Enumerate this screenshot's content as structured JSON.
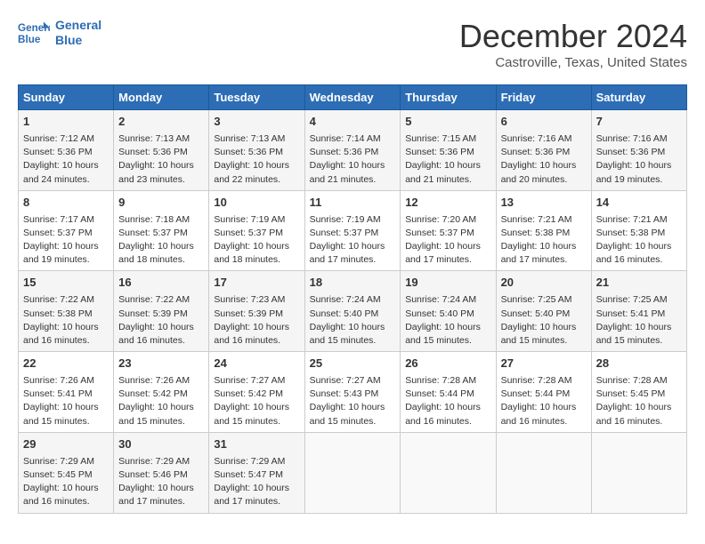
{
  "logo": {
    "line1": "General",
    "line2": "Blue"
  },
  "title": "December 2024",
  "subtitle": "Castroville, Texas, United States",
  "days_of_week": [
    "Sunday",
    "Monday",
    "Tuesday",
    "Wednesday",
    "Thursday",
    "Friday",
    "Saturday"
  ],
  "weeks": [
    [
      {
        "day": 1,
        "sunrise": "7:12 AM",
        "sunset": "5:36 PM",
        "daylight": "10 hours and 24 minutes."
      },
      {
        "day": 2,
        "sunrise": "7:13 AM",
        "sunset": "5:36 PM",
        "daylight": "10 hours and 23 minutes."
      },
      {
        "day": 3,
        "sunrise": "7:13 AM",
        "sunset": "5:36 PM",
        "daylight": "10 hours and 22 minutes."
      },
      {
        "day": 4,
        "sunrise": "7:14 AM",
        "sunset": "5:36 PM",
        "daylight": "10 hours and 21 minutes."
      },
      {
        "day": 5,
        "sunrise": "7:15 AM",
        "sunset": "5:36 PM",
        "daylight": "10 hours and 21 minutes."
      },
      {
        "day": 6,
        "sunrise": "7:16 AM",
        "sunset": "5:36 PM",
        "daylight": "10 hours and 20 minutes."
      },
      {
        "day": 7,
        "sunrise": "7:16 AM",
        "sunset": "5:36 PM",
        "daylight": "10 hours and 19 minutes."
      }
    ],
    [
      {
        "day": 8,
        "sunrise": "7:17 AM",
        "sunset": "5:37 PM",
        "daylight": "10 hours and 19 minutes."
      },
      {
        "day": 9,
        "sunrise": "7:18 AM",
        "sunset": "5:37 PM",
        "daylight": "10 hours and 18 minutes."
      },
      {
        "day": 10,
        "sunrise": "7:19 AM",
        "sunset": "5:37 PM",
        "daylight": "10 hours and 18 minutes."
      },
      {
        "day": 11,
        "sunrise": "7:19 AM",
        "sunset": "5:37 PM",
        "daylight": "10 hours and 17 minutes."
      },
      {
        "day": 12,
        "sunrise": "7:20 AM",
        "sunset": "5:37 PM",
        "daylight": "10 hours and 17 minutes."
      },
      {
        "day": 13,
        "sunrise": "7:21 AM",
        "sunset": "5:38 PM",
        "daylight": "10 hours and 17 minutes."
      },
      {
        "day": 14,
        "sunrise": "7:21 AM",
        "sunset": "5:38 PM",
        "daylight": "10 hours and 16 minutes."
      }
    ],
    [
      {
        "day": 15,
        "sunrise": "7:22 AM",
        "sunset": "5:38 PM",
        "daylight": "10 hours and 16 minutes."
      },
      {
        "day": 16,
        "sunrise": "7:22 AM",
        "sunset": "5:39 PM",
        "daylight": "10 hours and 16 minutes."
      },
      {
        "day": 17,
        "sunrise": "7:23 AM",
        "sunset": "5:39 PM",
        "daylight": "10 hours and 16 minutes."
      },
      {
        "day": 18,
        "sunrise": "7:24 AM",
        "sunset": "5:40 PM",
        "daylight": "10 hours and 15 minutes."
      },
      {
        "day": 19,
        "sunrise": "7:24 AM",
        "sunset": "5:40 PM",
        "daylight": "10 hours and 15 minutes."
      },
      {
        "day": 20,
        "sunrise": "7:25 AM",
        "sunset": "5:40 PM",
        "daylight": "10 hours and 15 minutes."
      },
      {
        "day": 21,
        "sunrise": "7:25 AM",
        "sunset": "5:41 PM",
        "daylight": "10 hours and 15 minutes."
      }
    ],
    [
      {
        "day": 22,
        "sunrise": "7:26 AM",
        "sunset": "5:41 PM",
        "daylight": "10 hours and 15 minutes."
      },
      {
        "day": 23,
        "sunrise": "7:26 AM",
        "sunset": "5:42 PM",
        "daylight": "10 hours and 15 minutes."
      },
      {
        "day": 24,
        "sunrise": "7:27 AM",
        "sunset": "5:42 PM",
        "daylight": "10 hours and 15 minutes."
      },
      {
        "day": 25,
        "sunrise": "7:27 AM",
        "sunset": "5:43 PM",
        "daylight": "10 hours and 15 minutes."
      },
      {
        "day": 26,
        "sunrise": "7:28 AM",
        "sunset": "5:44 PM",
        "daylight": "10 hours and 16 minutes."
      },
      {
        "day": 27,
        "sunrise": "7:28 AM",
        "sunset": "5:44 PM",
        "daylight": "10 hours and 16 minutes."
      },
      {
        "day": 28,
        "sunrise": "7:28 AM",
        "sunset": "5:45 PM",
        "daylight": "10 hours and 16 minutes."
      }
    ],
    [
      {
        "day": 29,
        "sunrise": "7:29 AM",
        "sunset": "5:45 PM",
        "daylight": "10 hours and 16 minutes."
      },
      {
        "day": 30,
        "sunrise": "7:29 AM",
        "sunset": "5:46 PM",
        "daylight": "10 hours and 17 minutes."
      },
      {
        "day": 31,
        "sunrise": "7:29 AM",
        "sunset": "5:47 PM",
        "daylight": "10 hours and 17 minutes."
      },
      null,
      null,
      null,
      null
    ]
  ]
}
